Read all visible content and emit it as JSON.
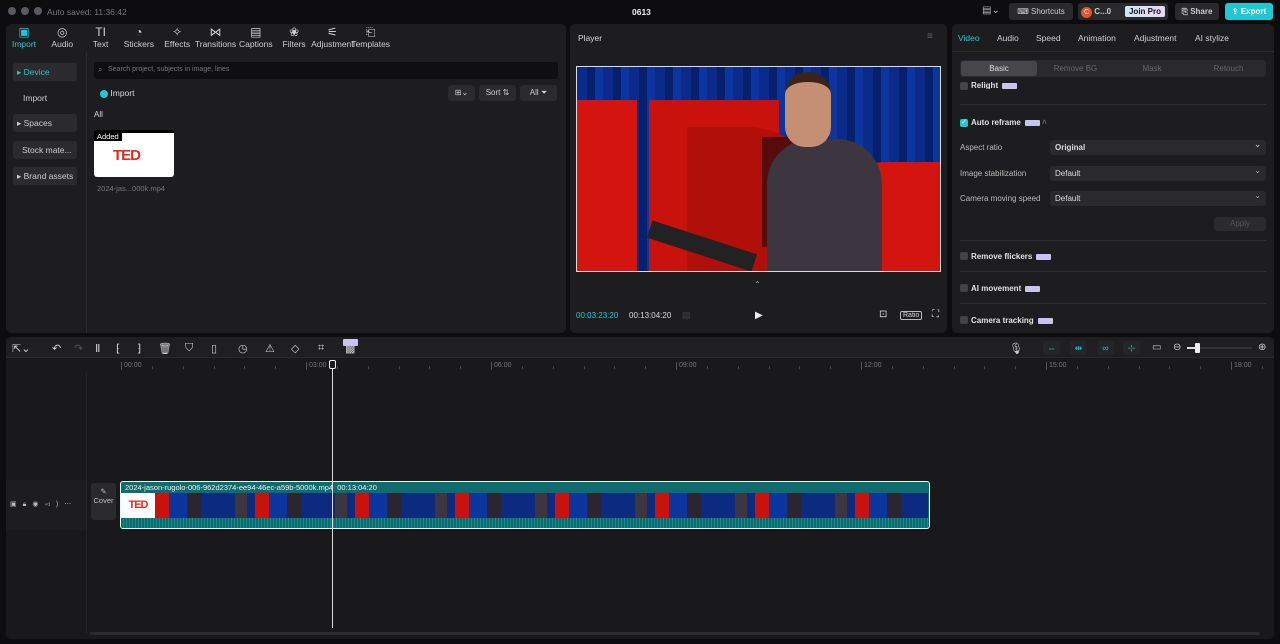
{
  "titlebar": {
    "autosave": "Auto saved: 11:36:42",
    "project": "0613",
    "shortcuts": "Shortcuts",
    "account": "C...0",
    "avatar_letter": "C",
    "join_pro": "Join Pro",
    "share": "Share",
    "export": "Export"
  },
  "media_tabs": [
    {
      "label": "Import",
      "icon": "import-icon",
      "active": true
    },
    {
      "label": "Audio",
      "icon": "audio-icon"
    },
    {
      "label": "Text",
      "icon": "text-icon"
    },
    {
      "label": "Stickers",
      "icon": "sticker-icon"
    },
    {
      "label": "Effects",
      "icon": "effects-icon"
    },
    {
      "label": "Transitions",
      "icon": "transitions-icon"
    },
    {
      "label": "Captions",
      "icon": "captions-icon"
    },
    {
      "label": "Filters",
      "icon": "filters-icon"
    },
    {
      "label": "Adjustment",
      "icon": "adjustment-icon"
    },
    {
      "label": "Templates",
      "icon": "templates-icon"
    }
  ],
  "sidebar": {
    "items": [
      {
        "label": "Device",
        "active": true
      },
      {
        "label": "Import"
      },
      {
        "label": "Spaces"
      },
      {
        "label": "Stock mate..."
      },
      {
        "label": "Brand assets"
      }
    ]
  },
  "media": {
    "search_placeholder": "Search project, subjects in image, lines",
    "import": "Import",
    "sort": "Sort",
    "filter": "All",
    "section": "All",
    "items": [
      {
        "badge": "Added",
        "thumb_text": "TED",
        "name": "2024-jas...000k.mp4"
      }
    ]
  },
  "player": {
    "title": "Player",
    "current_time": "00:03:23:20",
    "total_time": "00:13:04:20",
    "ratio": "Ratio"
  },
  "inspector": {
    "tabs": [
      "Video",
      "Audio",
      "Speed",
      "Animation",
      "Adjustment",
      "AI stylize"
    ],
    "subtabs": [
      "Basic",
      "Remove BG",
      "Mask",
      "Retouch"
    ],
    "relight": "Relight",
    "auto_reframe": "Auto reframe",
    "auto_reframe_checked": true,
    "fields": [
      {
        "label": "Aspect ratio",
        "value": "Original"
      },
      {
        "label": "Image stabilization",
        "value": "Default"
      },
      {
        "label": "Camera moving speed",
        "value": "Default"
      }
    ],
    "apply": "Apply",
    "remove_flickers": "Remove flickers",
    "ai_movement": "AI movement",
    "camera_tracking": "Camera tracking"
  },
  "timeline": {
    "ruler": [
      "00:00",
      "03:00",
      "06:00",
      "09:00",
      "12:00",
      "15:00",
      "18:00"
    ],
    "cover": "Cover",
    "clip_name": "2024-jason-rugolo-006-962d2374-ee94-46ec-a59b-5000k.mp4",
    "clip_duration": "00:13:04:20",
    "thumb_text": "TED",
    "playhead_fraction": 0.26,
    "zoom_level": 0.15
  },
  "colors": {
    "accent": "#1fc7d4",
    "clip": "#0e6b6e",
    "ted_red": "#e62b1e"
  }
}
